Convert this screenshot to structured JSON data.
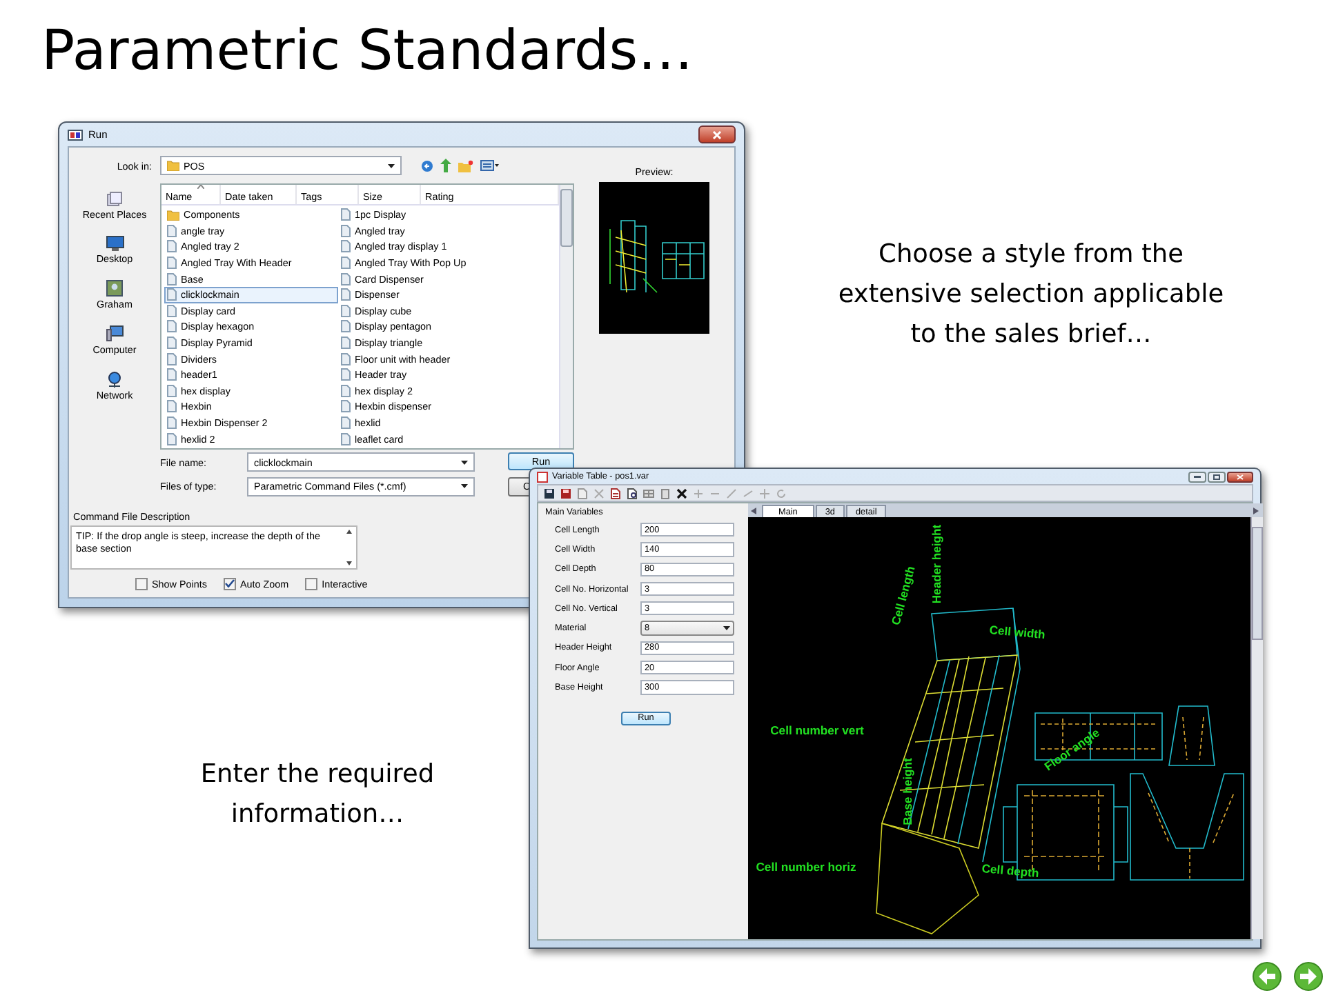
{
  "slide": {
    "title": "Parametric Standards…",
    "captions": [
      "Choose a style from the extensive selection applicable to the sales brief…",
      "Enter the required information…"
    ]
  },
  "run_dialog": {
    "title": "Run",
    "look_in": {
      "label": "Look in:",
      "value": "POS"
    },
    "columns": [
      "Name",
      "Date taken",
      "Tags",
      "Size",
      "Rating"
    ],
    "places": [
      "Recent Places",
      "Desktop",
      "Graham",
      "Computer",
      "Network"
    ],
    "files": [
      {
        "name": "Components",
        "kind": "folder",
        "selected": false
      },
      {
        "name": "angle tray",
        "kind": "file",
        "selected": false
      },
      {
        "name": "Angled tray 2",
        "kind": "file",
        "selected": false
      },
      {
        "name": "Angled Tray With Header",
        "kind": "file",
        "selected": false
      },
      {
        "name": "Base",
        "kind": "file",
        "selected": false
      },
      {
        "name": "clicklockmain",
        "kind": "file",
        "selected": true
      },
      {
        "name": "Display card",
        "kind": "file",
        "selected": false
      },
      {
        "name": "Display hexagon",
        "kind": "file",
        "selected": false
      },
      {
        "name": "Display Pyramid",
        "kind": "file",
        "selected": false
      },
      {
        "name": "Dividers",
        "kind": "file",
        "selected": false
      },
      {
        "name": "header1",
        "kind": "file",
        "selected": false
      },
      {
        "name": "hex display",
        "kind": "file",
        "selected": false
      },
      {
        "name": "Hexbin",
        "kind": "file",
        "selected": false
      },
      {
        "name": "Hexbin Dispenser 2",
        "kind": "file",
        "selected": false
      },
      {
        "name": "hexlid 2",
        "kind": "file",
        "selected": false
      },
      {
        "name": "1pc Display",
        "kind": "file",
        "selected": false
      },
      {
        "name": "Angled tray",
        "kind": "file",
        "selected": false
      },
      {
        "name": "Angled tray display 1",
        "kind": "file",
        "selected": false
      },
      {
        "name": "Angled Tray With Pop Up",
        "kind": "file",
        "selected": false
      },
      {
        "name": "Card Dispenser",
        "kind": "file",
        "selected": false
      },
      {
        "name": "Dispenser",
        "kind": "file",
        "selected": false
      },
      {
        "name": "Display cube",
        "kind": "file",
        "selected": false
      },
      {
        "name": "Display pentagon",
        "kind": "file",
        "selected": false
      },
      {
        "name": "Display triangle",
        "kind": "file",
        "selected": false
      },
      {
        "name": "Floor unit with header",
        "kind": "file",
        "selected": false
      },
      {
        "name": "Header tray",
        "kind": "file",
        "selected": false
      },
      {
        "name": "hex display 2",
        "kind": "file",
        "selected": false
      },
      {
        "name": "Hexbin dispenser",
        "kind": "file",
        "selected": false
      },
      {
        "name": "hexlid",
        "kind": "file",
        "selected": false
      },
      {
        "name": "leaflet card",
        "kind": "file",
        "selected": false
      }
    ],
    "preview_label": "Preview:",
    "file_name": {
      "label": "File name:",
      "value": "clicklockmain"
    },
    "file_type": {
      "label": "Files of type:",
      "value": "Parametric Command Files (*.cmf)"
    },
    "buttons": [
      "Run",
      "C"
    ],
    "description": {
      "label": "Command File Description",
      "text": "TIP: If the drop angle is steep, increase the depth of the base section"
    },
    "options": [
      {
        "label": "Show Points",
        "checked": false
      },
      {
        "label": "Auto Zoom",
        "checked": true
      },
      {
        "label": "Interactive",
        "checked": false
      }
    ]
  },
  "variable_window": {
    "title": "Variable Table - pos1.var",
    "group_label": "Main Variables",
    "fields": [
      {
        "label": "Cell Length",
        "value": "200",
        "kind": "text"
      },
      {
        "label": "Cell Width",
        "value": "140",
        "kind": "text"
      },
      {
        "label": "Cell Depth",
        "value": "80",
        "kind": "text"
      },
      {
        "label": "Cell No. Horizontal",
        "value": "3",
        "kind": "text"
      },
      {
        "label": "Cell No. Vertical",
        "value": "3",
        "kind": "text"
      },
      {
        "label": "Material",
        "value": "8",
        "kind": "select"
      },
      {
        "label": "Header Height",
        "value": "280",
        "kind": "text"
      },
      {
        "label": "Floor Angle",
        "value": "20",
        "kind": "text"
      },
      {
        "label": "Base Height",
        "value": "300",
        "kind": "text"
      }
    ],
    "run_button": "Run",
    "tabs": [
      {
        "label": "Main",
        "selected": true
      },
      {
        "label": "3d",
        "selected": false
      },
      {
        "label": "detail",
        "selected": false
      }
    ],
    "drawing_labels": [
      "Cell length",
      "Header height",
      "Cell width",
      "Cell number vert",
      "Floor angle",
      "Base height",
      "Cell number horiz",
      "Cell depth"
    ]
  }
}
